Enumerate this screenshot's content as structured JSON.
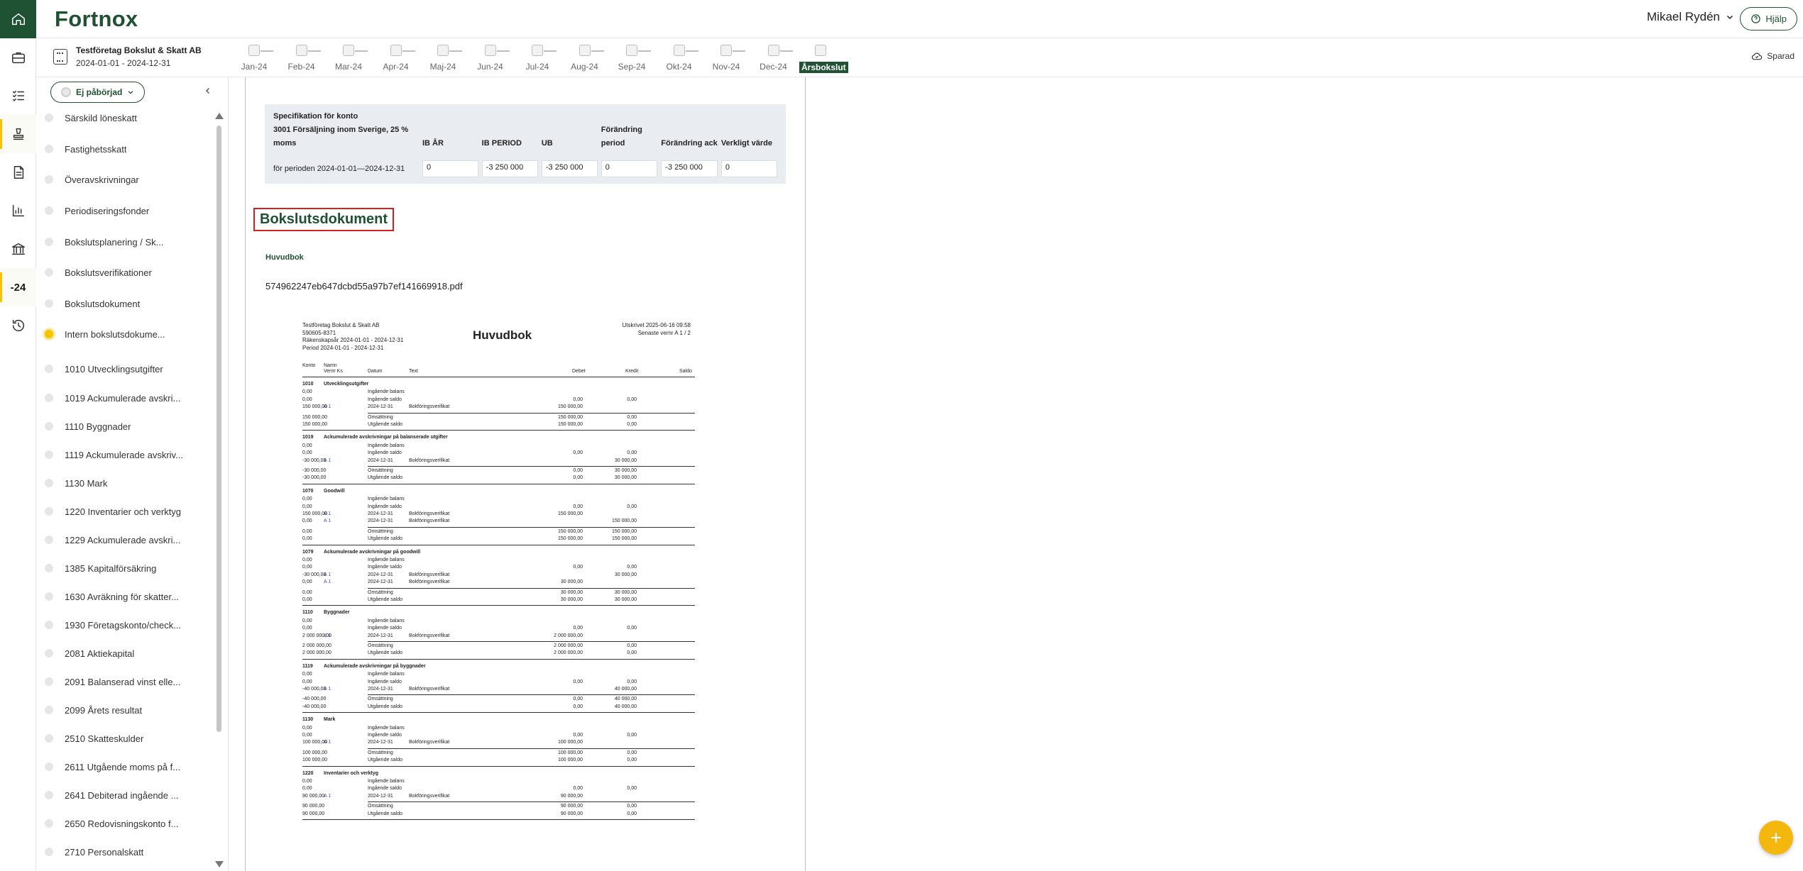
{
  "app": {
    "logo": "Fortnox"
  },
  "topbar": {
    "user_name": "Mikael Rydén",
    "help_label": "Hjälp"
  },
  "rail": {
    "year_label": "-24",
    "icons": [
      "home-icon",
      "briefcase-icon",
      "checklist-icon",
      "stamp-icon",
      "document-icon",
      "chart-icon",
      "bank-icon",
      "history-icon"
    ]
  },
  "company": {
    "name": "Testföretag Bokslut & Skatt AB",
    "period": "2024-01-01 - 2024-12-31"
  },
  "months": [
    "Jan-24",
    "Feb-24",
    "Mar-24",
    "Apr-24",
    "Maj-24",
    "Jun-24",
    "Jul-24",
    "Aug-24",
    "Sep-24",
    "Okt-24",
    "Nov-24",
    "Dec-24",
    "Årsbokslut"
  ],
  "months_active_index": 12,
  "save_status": "Sparad",
  "sidebar": {
    "status_label": "Ej påbörjad",
    "items": [
      "Särskild löneskatt",
      "Fastighetsskatt",
      "Överavskrivningar",
      "Periodiseringsfonder",
      "Bokslutsplanering / Sk...",
      "Bokslutsverifikationer",
      "Bokslutsdokument",
      "Intern bokslutsdokume...",
      "1010 Utvecklingsutgifter",
      "1019 Ackumulerade avskri...",
      "1110 Byggnader",
      "1119 Ackumulerade avskriv...",
      "1130 Mark",
      "1220 Inventarier och verktyg",
      "1229 Ackumulerade avskri...",
      "1385 Kapitalförsäkring",
      "1630 Avräkning för skatter...",
      "1930 Företagskonto/check...",
      "2081 Aktiekapital",
      "2091 Balanserad vinst elle...",
      "2099 Årets resultat",
      "2510 Skatteskulder",
      "2611 Utgående moms på f...",
      "2641 Debiterad ingående ...",
      "2650 Redovisningskonto f...",
      "2710 Personalskatt"
    ],
    "current_index": 7
  },
  "spec": {
    "title_line1": "Specifikation för konto",
    "title_line2": "3001 Försäljning inom Sverige, 25 %",
    "title_line3": "moms",
    "headers": [
      "IB ÅR",
      "IB PERIOD",
      "UB",
      "Förändring period",
      "Förändring ack",
      "Verkligt värde"
    ],
    "row_label": "för perioden 2024-01-01—2024-12-31",
    "values": [
      "0",
      "-3 250 000",
      "-3 250 000",
      "0",
      "-3 250 000",
      "0"
    ]
  },
  "section": {
    "title": "Bokslutsdokument",
    "subtitle": "Huvudbok",
    "filename": "574962247eb647dcbd55a97b7ef141669918.pdf"
  },
  "pdf": {
    "company_lines": [
      "Testföretag Bokslut & Skatt AB",
      "590605-8371",
      "Räkenskapsår 2024-01-01 - 2024-12-31",
      "Period 2024-01-01 - 2024-12-31"
    ],
    "title": "Huvudbok",
    "printed_lines": [
      "Utskrivet 2025-06-16 09:58",
      "Senaste vernr A 1 / 2"
    ],
    "col_headers": {
      "konto": "Konto",
      "namn": "Namn",
      "vernr": "Vernr Ks",
      "datum": "Datum",
      "text": "Text",
      "debet": "Debet",
      "kredit": "Kredit",
      "saldo": "Saldo"
    },
    "accounts": [
      {
        "no": "1010",
        "name": "Utvecklingsutgifter",
        "rows": [
          {
            "t": "Ingående balans",
            "d": "",
            "k": "",
            "s": "0,00"
          },
          {
            "t": "Ingående saldo",
            "d": "0,00",
            "k": "0,00",
            "s": "0,00"
          },
          {
            "v": "A 1",
            "dt": "2024-12-31",
            "t": "Bokföringsverifikat",
            "d": "150 000,00",
            "k": "",
            "s": "150 000,00"
          }
        ],
        "sum": [
          {
            "t": "Omsättning",
            "d": "150 000,00",
            "k": "0,00",
            "s": "150 000,00"
          },
          {
            "t": "Utgående saldo",
            "d": "150 000,00",
            "k": "0,00",
            "s": "150 000,00"
          }
        ]
      },
      {
        "no": "1019",
        "name": "Ackumulerade avskrivningar på balanserade utgifter",
        "rows": [
          {
            "t": "Ingående balans",
            "d": "",
            "k": "",
            "s": "0,00"
          },
          {
            "t": "Ingående saldo",
            "d": "0,00",
            "k": "0,00",
            "s": "0,00"
          },
          {
            "v": "A 1",
            "dt": "2024-12-31",
            "t": "Bokföringsverifikat",
            "d": "",
            "k": "30 000,00",
            "s": "-30 000,00"
          }
        ],
        "sum": [
          {
            "t": "Omsättning",
            "d": "0,00",
            "k": "30 000,00",
            "s": "-30 000,00"
          },
          {
            "t": "Utgående saldo",
            "d": "0,00",
            "k": "30 000,00",
            "s": "-30 000,00"
          }
        ]
      },
      {
        "no": "1070",
        "name": "Goodwill",
        "rows": [
          {
            "t": "Ingående balans",
            "d": "",
            "k": "",
            "s": "0,00"
          },
          {
            "t": "Ingående saldo",
            "d": "0,00",
            "k": "0,00",
            "s": "0,00"
          },
          {
            "v": "A 1",
            "dt": "2024-12-31",
            "t": "Bokföringsverifikat",
            "d": "150 000,00",
            "k": "",
            "s": "150 000,00"
          },
          {
            "v": "A 1",
            "dt": "2024-12-31",
            "t": "Bokföringsverifikat",
            "d": "",
            "k": "150 000,00",
            "s": "0,00"
          }
        ],
        "sum": [
          {
            "t": "Omsättning",
            "d": "150 000,00",
            "k": "150 000,00",
            "s": "0,00"
          },
          {
            "t": "Utgående saldo",
            "d": "150 000,00",
            "k": "150 000,00",
            "s": "0,00"
          }
        ]
      },
      {
        "no": "1079",
        "name": "Ackumulerade avskrivningar på goodwill",
        "rows": [
          {
            "t": "Ingående balans",
            "d": "",
            "k": "",
            "s": "0,00"
          },
          {
            "t": "Ingående saldo",
            "d": "0,00",
            "k": "0,00",
            "s": "0,00"
          },
          {
            "v": "A 1",
            "dt": "2024-12-31",
            "t": "Bokföringsverifikat",
            "d": "",
            "k": "30 000,00",
            "s": "-30 000,00"
          },
          {
            "v": "A 1",
            "dt": "2024-12-31",
            "t": "Bokföringsverifikat",
            "d": "30 000,00",
            "k": "",
            "s": "0,00"
          }
        ],
        "sum": [
          {
            "t": "Omsättning",
            "d": "30 000,00",
            "k": "30 000,00",
            "s": "0,00"
          },
          {
            "t": "Utgående saldo",
            "d": "30 000,00",
            "k": "30 000,00",
            "s": "0,00"
          }
        ]
      },
      {
        "no": "1110",
        "name": "Byggnader",
        "rows": [
          {
            "t": "Ingående balans",
            "d": "",
            "k": "",
            "s": "0,00"
          },
          {
            "t": "Ingående saldo",
            "d": "0,00",
            "k": "0,00",
            "s": "0,00"
          },
          {
            "v": "A 1",
            "dt": "2024-12-31",
            "t": "Bokföringsverifikat",
            "d": "2 000 000,00",
            "k": "",
            "s": "2 000 000,00"
          }
        ],
        "sum": [
          {
            "t": "Omsättning",
            "d": "2 000 000,00",
            "k": "0,00",
            "s": "2 000 000,00"
          },
          {
            "t": "Utgående saldo",
            "d": "2 000 000,00",
            "k": "0,00",
            "s": "2 000 000,00"
          }
        ]
      },
      {
        "no": "1119",
        "name": "Ackumulerade avskrivningar på byggnader",
        "rows": [
          {
            "t": "Ingående balans",
            "d": "",
            "k": "",
            "s": "0,00"
          },
          {
            "t": "Ingående saldo",
            "d": "0,00",
            "k": "0,00",
            "s": "0,00"
          },
          {
            "v": "A 1",
            "dt": "2024-12-31",
            "t": "Bokföringsverifikat",
            "d": "",
            "k": "40 000,00",
            "s": "-40 000,00"
          }
        ],
        "sum": [
          {
            "t": "Omsättning",
            "d": "0,00",
            "k": "40 000,00",
            "s": "-40 000,00"
          },
          {
            "t": "Utgående saldo",
            "d": "0,00",
            "k": "40 000,00",
            "s": "-40 000,00"
          }
        ]
      },
      {
        "no": "1130",
        "name": "Mark",
        "rows": [
          {
            "t": "Ingående balans",
            "d": "",
            "k": "",
            "s": "0,00"
          },
          {
            "t": "Ingående saldo",
            "d": "0,00",
            "k": "0,00",
            "s": "0,00"
          },
          {
            "v": "A 1",
            "dt": "2024-12-31",
            "t": "Bokföringsverifikat",
            "d": "100 000,00",
            "k": "",
            "s": "100 000,00"
          }
        ],
        "sum": [
          {
            "t": "Omsättning",
            "d": "100 000,00",
            "k": "0,00",
            "s": "100 000,00"
          },
          {
            "t": "Utgående saldo",
            "d": "100 000,00",
            "k": "0,00",
            "s": "100 000,00"
          }
        ]
      },
      {
        "no": "1220",
        "name": "Inventarier och verktyg",
        "rows": [
          {
            "t": "Ingående balans",
            "d": "",
            "k": "",
            "s": "0,00"
          },
          {
            "t": "Ingående saldo",
            "d": "0,00",
            "k": "0,00",
            "s": "0,00"
          },
          {
            "v": "A 1",
            "dt": "2024-12-31",
            "t": "Bokföringsverifikat",
            "d": "90 000,00",
            "k": "",
            "s": "90 000,00"
          }
        ],
        "sum": [
          {
            "t": "Omsättning",
            "d": "90 000,00",
            "k": "0,00",
            "s": "90 000,00"
          },
          {
            "t": "Utgående saldo",
            "d": "90 000,00",
            "k": "0,00",
            "s": "90 000,00"
          }
        ]
      }
    ]
  },
  "colors": {
    "brand_green": "#1f5133",
    "accent_yellow": "#f3c400",
    "highlight_red": "#d12222"
  }
}
